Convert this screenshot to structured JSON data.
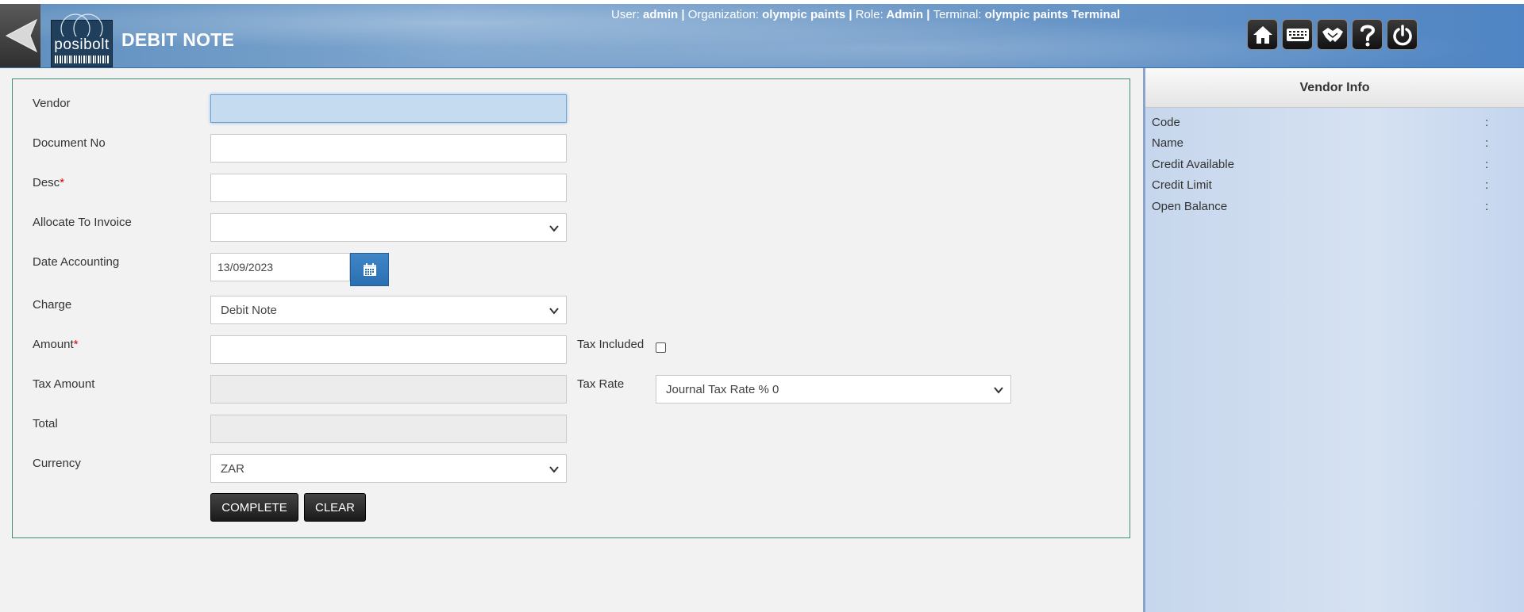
{
  "header": {
    "title": "DEBIT NOTE",
    "logo_text": "posibolt",
    "user_label": "User:",
    "user": "admin",
    "org_label": "Organization:",
    "org": "olympic paints",
    "role_label": "Role:",
    "role": "Admin",
    "terminal_label": "Terminal:",
    "terminal": "olympic paints Terminal",
    "separator": "|",
    "toolbar_icons": [
      "home-icon",
      "keyboard-icon",
      "handshake-icon",
      "help-icon",
      "power-icon"
    ]
  },
  "form": {
    "vendor_label": "Vendor",
    "vendor_value": "",
    "docno_label": "Document No",
    "docno_value": "",
    "desc_label": "Desc",
    "desc_value": "",
    "required_mark": "*",
    "allocate_label": "Allocate To Invoice",
    "allocate_value": "",
    "date_label": "Date Accounting",
    "date_value": "13/09/2023",
    "charge_label": "Charge",
    "charge_value": "Debit Note",
    "amount_label": "Amount",
    "amount_value": "",
    "tax_included_label": "Tax Included",
    "tax_included_checked": false,
    "tax_amount_label": "Tax Amount",
    "tax_amount_value": "",
    "tax_rate_label": "Tax Rate",
    "tax_rate_value": "Journal Tax Rate % 0",
    "total_label": "Total",
    "total_value": "",
    "currency_label": "Currency",
    "currency_value": "ZAR",
    "complete_label": "COMPLETE",
    "clear_label": "CLEAR"
  },
  "vendor_info": {
    "title": "Vendor Info",
    "rows": [
      {
        "label": "Code",
        "sep": ":"
      },
      {
        "label": "Name",
        "sep": ":"
      },
      {
        "label": "Credit Available",
        "sep": ":"
      },
      {
        "label": "Credit Limit",
        "sep": ":"
      },
      {
        "label": "Open Balance",
        "sep": ":"
      }
    ]
  },
  "colors": {
    "header_blue": "#6f9ac8",
    "panel_border": "#3f8f6f",
    "focus_field": "#c5dcf0",
    "calendar_button": "#2a6fb0",
    "required": "#dd0000"
  }
}
